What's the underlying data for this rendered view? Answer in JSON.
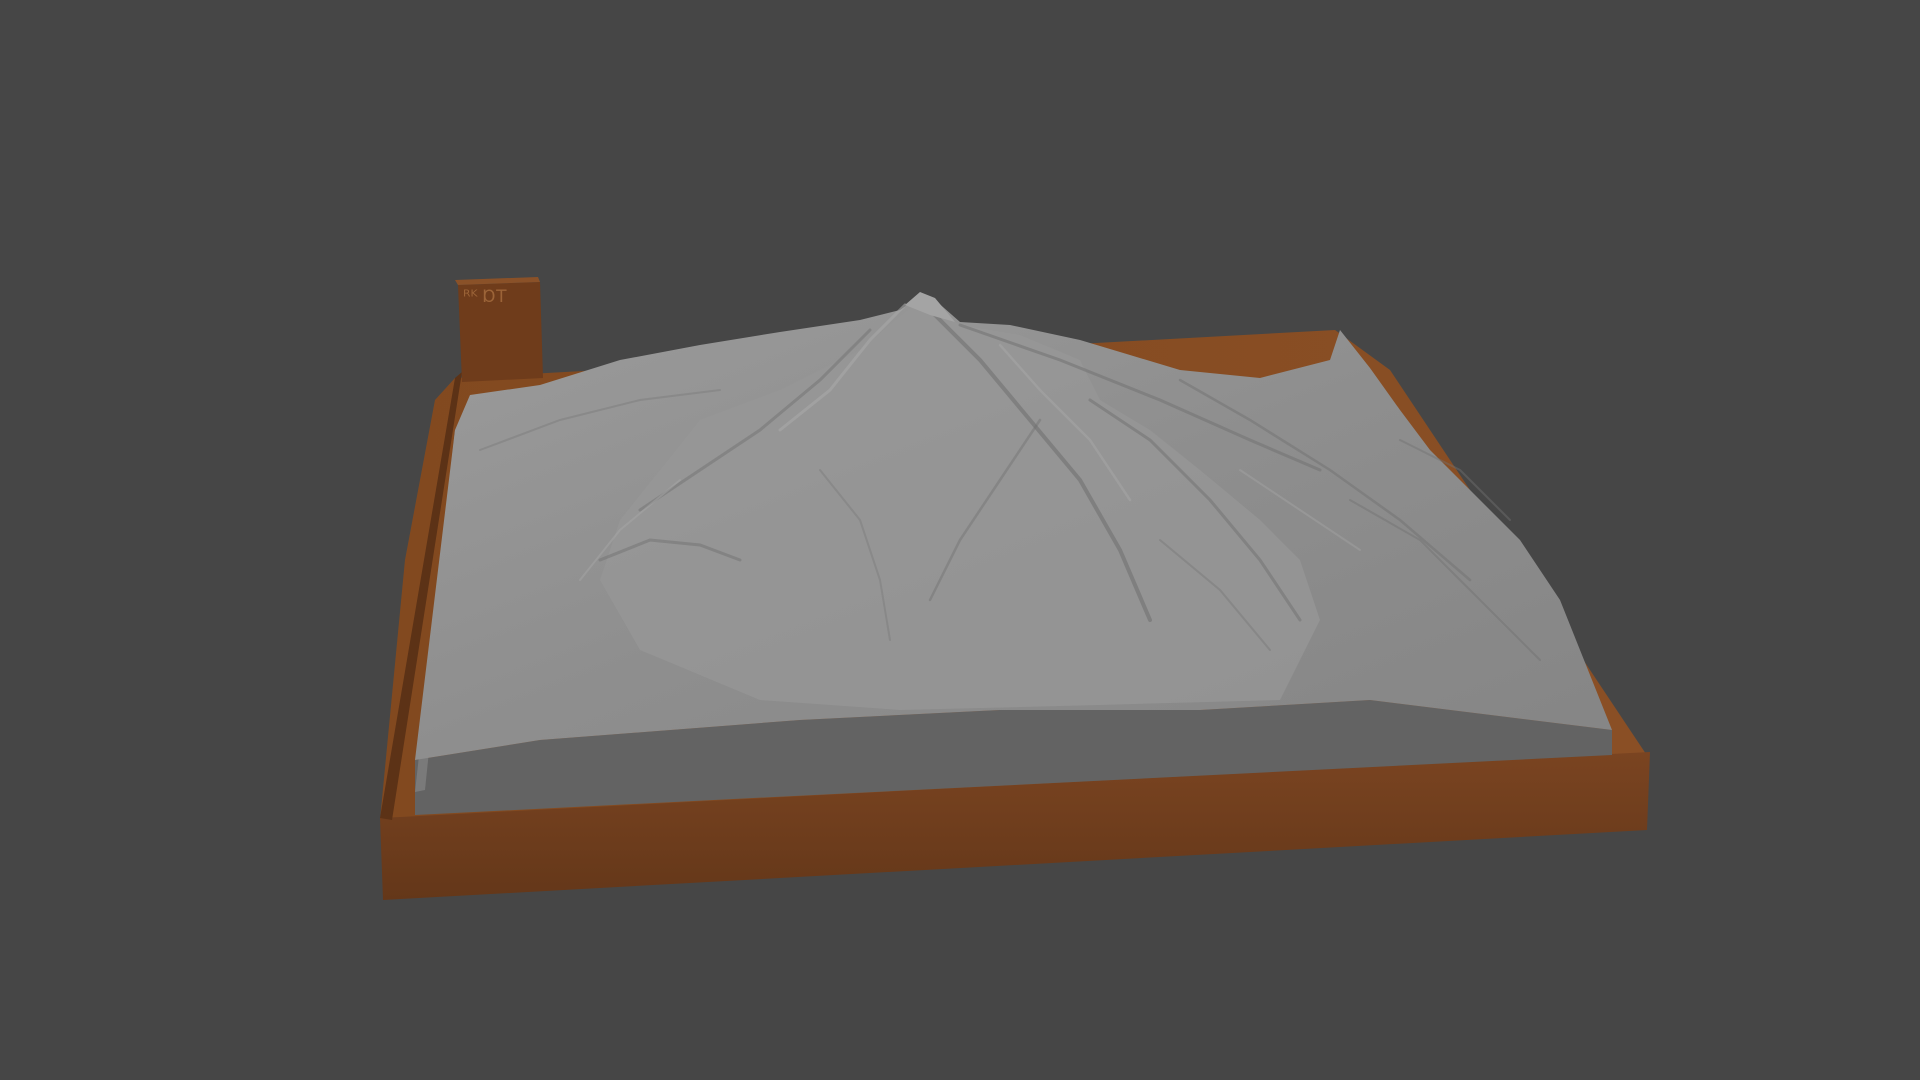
{
  "scene": {
    "background_color": "#464646",
    "model": "terrain-relief-model",
    "base_color": "#6e3d1e",
    "base_highlight_color": "#7d4622",
    "terrain_color": "#8c8c8c",
    "terrain_light_color": "#9a9a9a",
    "terrain_shadow_color": "#6f6f6f",
    "side_wall_color": "#636363",
    "label_block_text": "ᴿᴷ ⱰT"
  }
}
